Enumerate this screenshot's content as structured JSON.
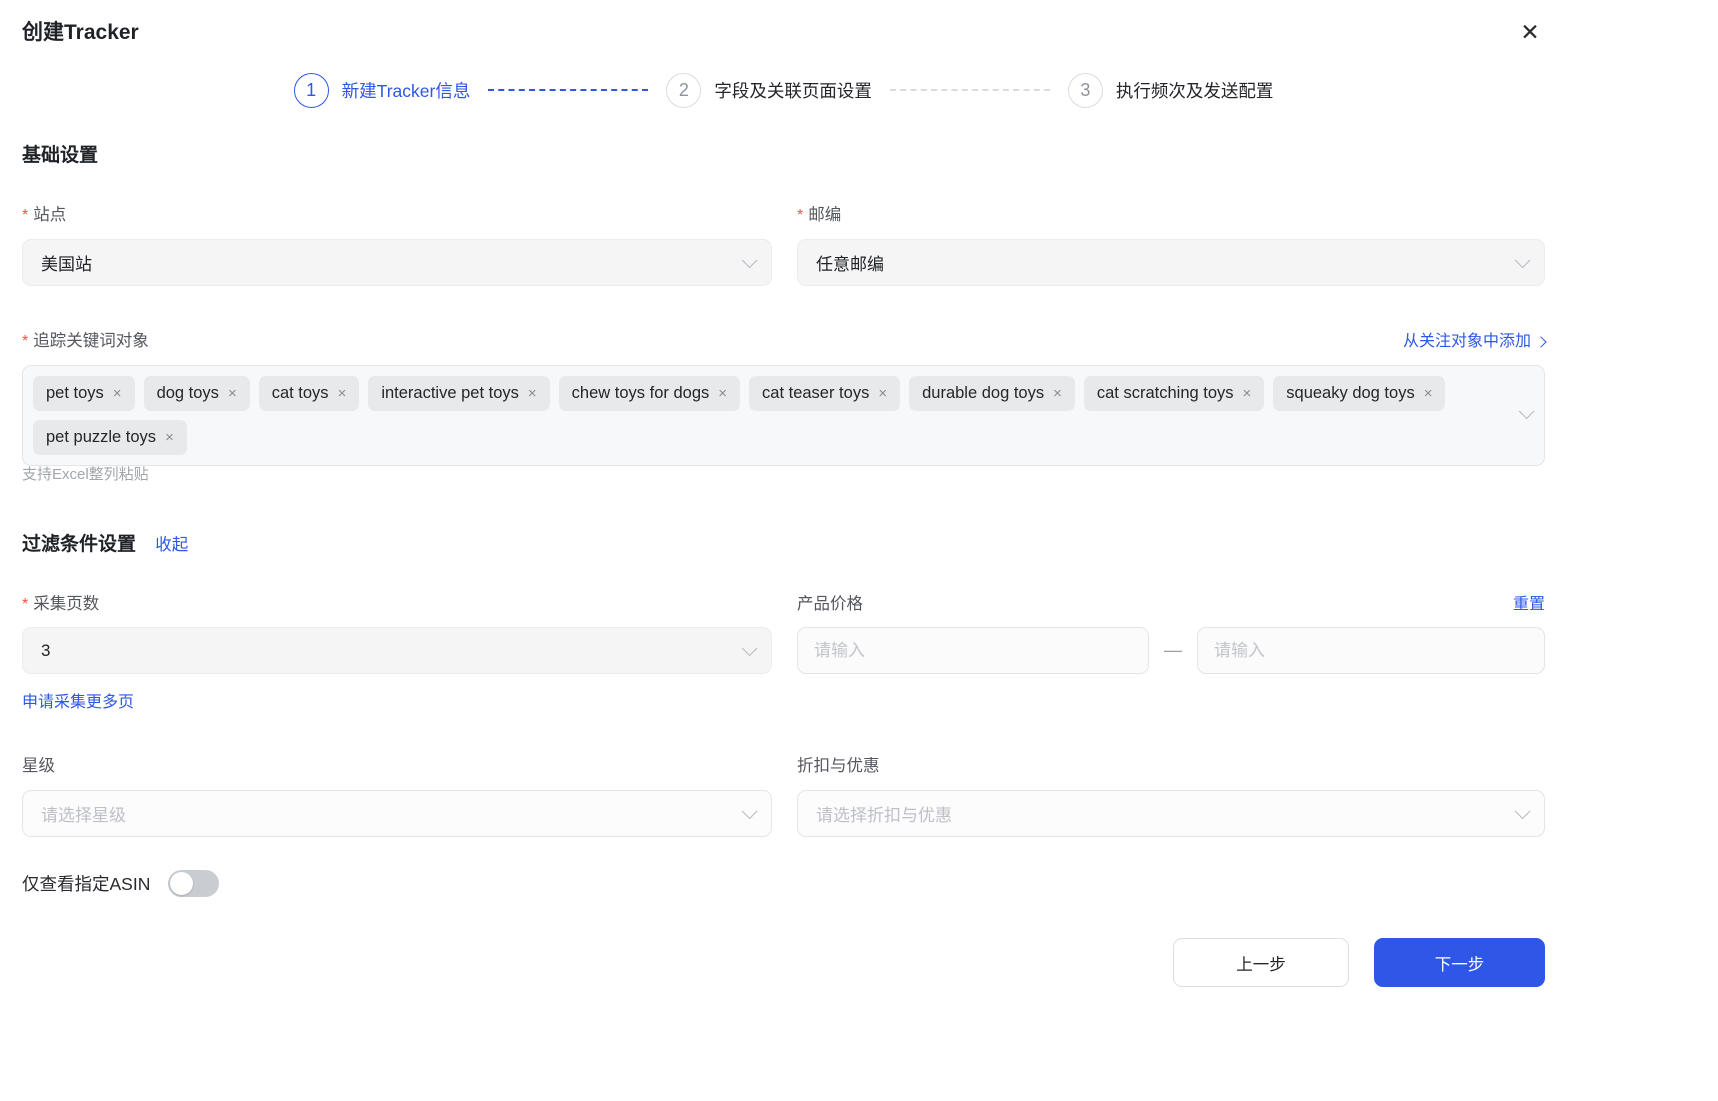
{
  "colors": {
    "accent": "#2f57e7",
    "required": "#f55145"
  },
  "ui": {
    "required_marker": "*",
    "close_icon": "✕",
    "remove_tag_icon": "×",
    "range_separator": "—"
  },
  "dialog": {
    "title": "创建Tracker"
  },
  "stepper": {
    "steps": [
      {
        "number": "1",
        "label": "新建Tracker信息",
        "state": "active"
      },
      {
        "number": "2",
        "label": "字段及关联页面设置",
        "state": "upcoming"
      },
      {
        "number": "3",
        "label": "执行频次及发送配置",
        "state": "upcoming"
      }
    ]
  },
  "basic": {
    "heading": "基础设置",
    "site": {
      "label": "站点",
      "value": "美国站"
    },
    "zipcode": {
      "label": "邮编",
      "value": "任意邮编"
    },
    "keywords": {
      "label": "追踪关键词对象",
      "add_link": "从关注对象中添加",
      "tags": [
        "pet toys",
        "dog toys",
        "cat toys",
        "interactive pet toys",
        "chew toys for dogs",
        "cat teaser toys",
        "durable dog toys",
        "cat scratching toys",
        "squeaky dog toys",
        "pet puzzle toys"
      ],
      "hint": "支持Excel整列粘贴"
    }
  },
  "filters": {
    "heading": "过滤条件设置",
    "collapse_link": "收起",
    "pages": {
      "label": "采集页数",
      "value": "3",
      "more_link": "申请采集更多页"
    },
    "price": {
      "label": "产品价格",
      "reset_link": "重置",
      "min_placeholder": "请输入",
      "max_placeholder": "请输入"
    },
    "rating": {
      "label": "星级",
      "placeholder": "请选择星级"
    },
    "discount": {
      "label": "折扣与优惠",
      "placeholder": "请选择折扣与优惠"
    },
    "asin_toggle": {
      "label": "仅查看指定ASIN",
      "state": "off"
    }
  },
  "footer": {
    "prev_label": "上一步",
    "next_label": "下一步"
  }
}
